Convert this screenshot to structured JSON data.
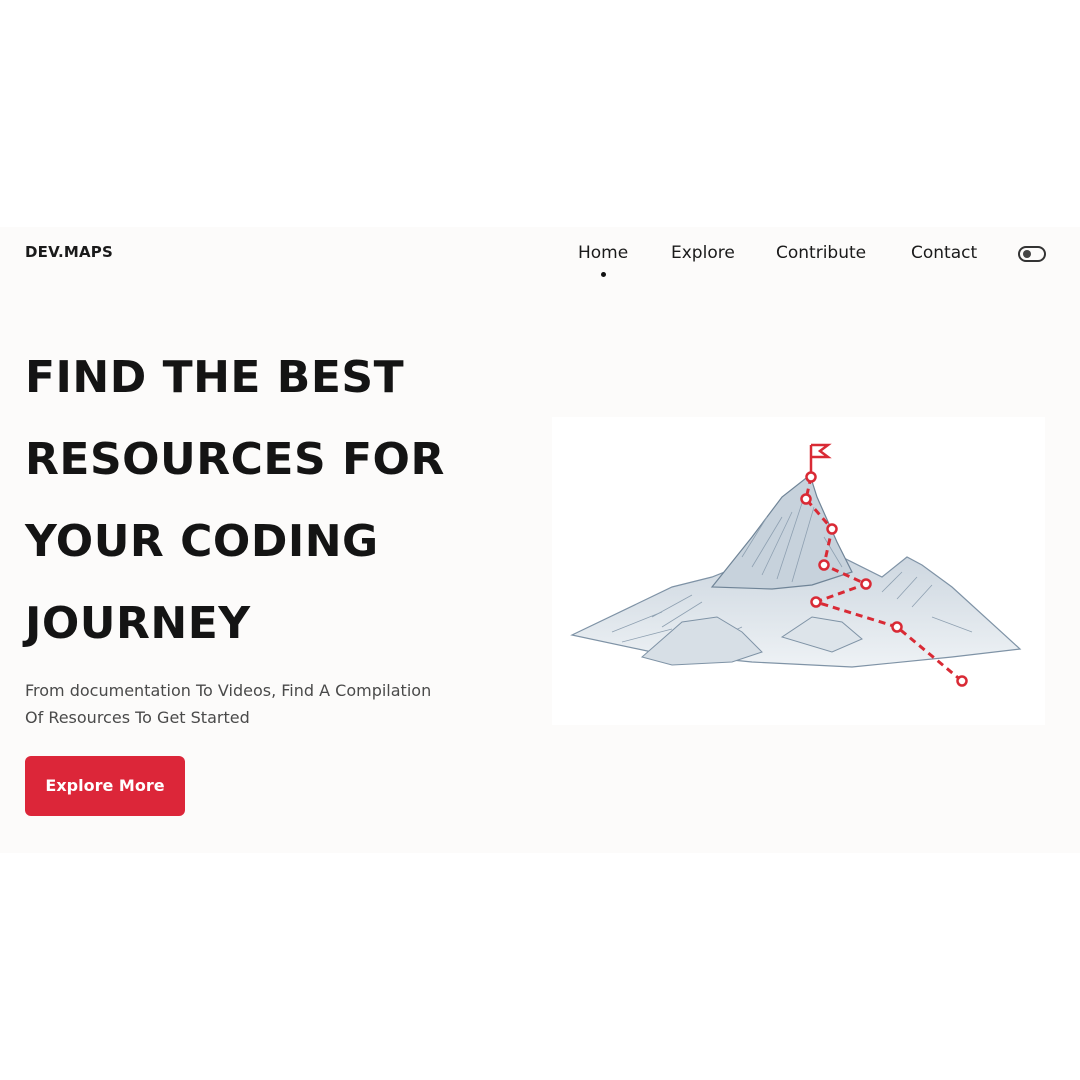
{
  "header": {
    "logo": "DEV.MAPS",
    "nav": [
      {
        "label": "Home",
        "active": true
      },
      {
        "label": "Explore",
        "active": false
      },
      {
        "label": "Contribute",
        "active": false
      },
      {
        "label": "Contact",
        "active": false
      }
    ],
    "theme_toggle_icon": "toggle-icon"
  },
  "hero": {
    "headline_lines": [
      "FIND THE BEST",
      "RESOURCES FOR",
      "YOUR CODING",
      "JOURNEY"
    ],
    "subtext_lines": [
      "From documentation To Videos, Find A Compilation",
      "Of Resources To Get Started"
    ],
    "cta_label": "Explore More",
    "illustration_icon": "mountain-path-illustration"
  },
  "colors": {
    "accent": "#dc2639",
    "background": "#fcfbfa",
    "text": "#141414"
  }
}
